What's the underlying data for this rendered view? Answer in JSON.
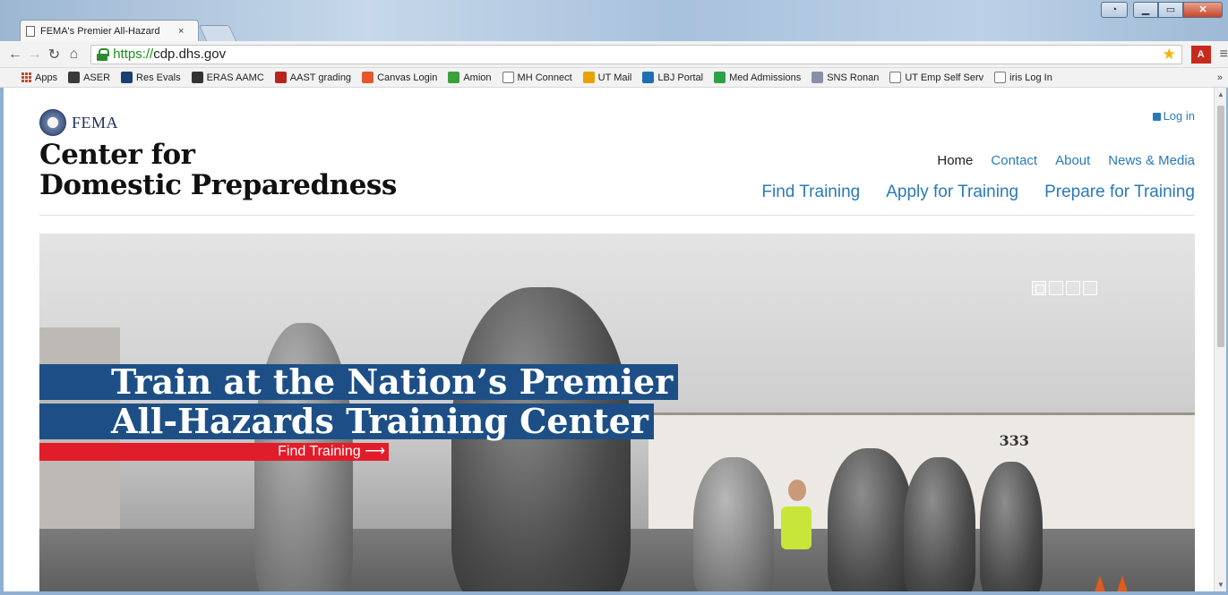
{
  "browser": {
    "tab_title": "FEMA's Premier All-Hazard",
    "tab_close": "×",
    "url_scheme": "https://",
    "url_host": "cdp.dhs.gov",
    "bookmarks": [
      {
        "label": "Apps",
        "icon": "apps-grid-icon",
        "color": "#c04a2a"
      },
      {
        "label": "ASER",
        "icon": "aser-icon",
        "color": "#3a3a3a"
      },
      {
        "label": "Res Evals",
        "icon": "new-innovations-icon",
        "color": "#1b3f73"
      },
      {
        "label": "ERAS AAMC",
        "icon": "eras-icon",
        "color": "#333333"
      },
      {
        "label": "AAST grading",
        "icon": "aast-icon",
        "color": "#b8231c"
      },
      {
        "label": "Canvas Login",
        "icon": "canvas-icon",
        "color": "#e4572e"
      },
      {
        "label": "Amion",
        "icon": "amion-icon",
        "color": "#3aa13a"
      },
      {
        "label": "MH Connect",
        "icon": "page-icon",
        "color": "#ffffff"
      },
      {
        "label": "UT Mail",
        "icon": "outlook-icon",
        "color": "#e8a100"
      },
      {
        "label": "LBJ Portal",
        "icon": "portal-icon",
        "color": "#1f6fb5"
      },
      {
        "label": "Med Admissions",
        "icon": "med-admissions-icon",
        "color": "#2fa04a"
      },
      {
        "label": "SNS Ronan",
        "icon": "sns-icon",
        "color": "#8a8fa8"
      },
      {
        "label": "UT Emp Self Serv",
        "icon": "page-icon",
        "color": "#ffffff"
      },
      {
        "label": "iris Log In",
        "icon": "page-icon",
        "color": "#ffffff"
      }
    ],
    "bookmarks_more": "»"
  },
  "site": {
    "agency": "FEMA",
    "title_line1": "Center for",
    "title_line2": "Domestic Preparedness",
    "login": "Log in",
    "nav_top": [
      "Home",
      "Contact",
      "About",
      "News & Media"
    ],
    "nav_main": [
      "Find Training",
      "Apply for Training",
      "Prepare for Training"
    ]
  },
  "hero": {
    "headline_line1": "Train at the Nation’s Premier",
    "headline_line2": "All-Hazards Training Center",
    "cta": "Find Training ⟶",
    "building_number": "333",
    "slides": 4,
    "active_slide": 1
  },
  "colors": {
    "link": "#2a7ab8",
    "headline_bg": "#1d4f86",
    "cta_bg": "#e21d2b"
  }
}
